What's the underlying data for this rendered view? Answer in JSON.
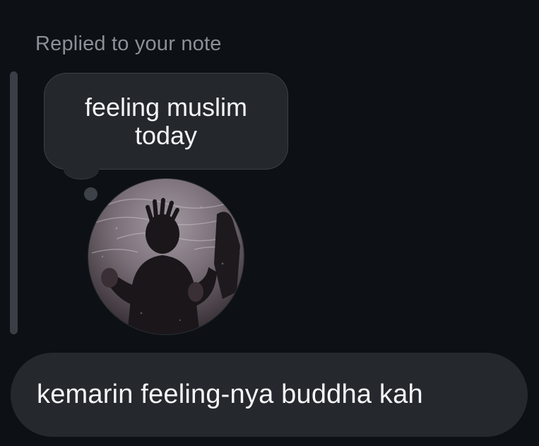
{
  "reply_context": {
    "label": "Replied to your note"
  },
  "note": {
    "text": "feeling muslim today"
  },
  "avatar": {
    "icon": "profile-photo"
  },
  "message": {
    "text": "kemarin feeling-nya buddha kah"
  },
  "colors": {
    "background": "#0d1014",
    "bubble": "#25292e",
    "label": "#8b9098",
    "quote_bar": "#3b3f45"
  }
}
